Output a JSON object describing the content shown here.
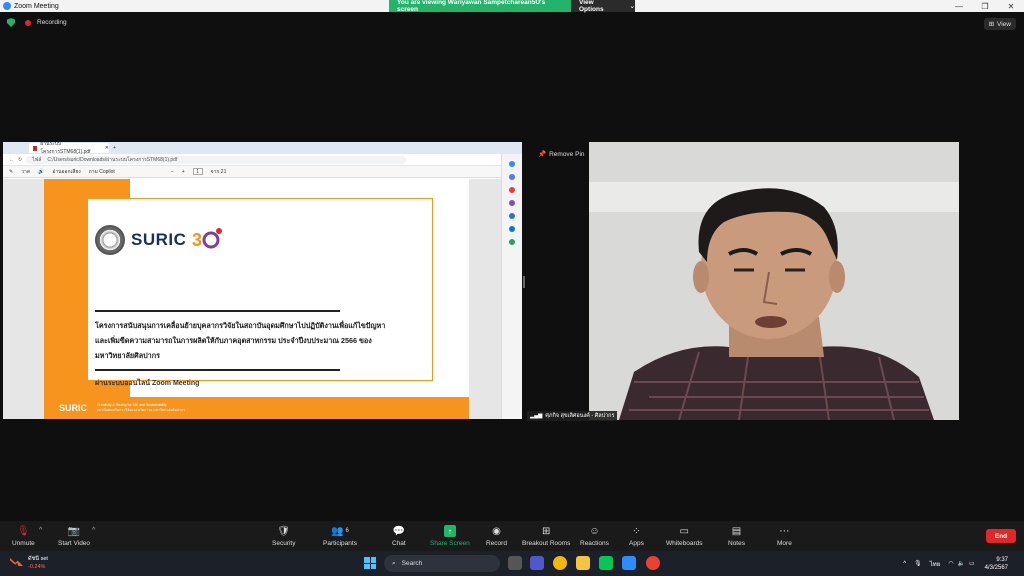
{
  "titlebar": {
    "app_title": "Zoom Meeting",
    "viewing_banner": "You are viewing Wariyawan Sampetcharean5U's screen",
    "view_options": "View Options"
  },
  "recording": {
    "label": "Recording"
  },
  "view_button": "View",
  "browser": {
    "tab_title": "ผ่านระบบโครงการSTM68(1).pdf",
    "url": "C:/Users/suric/Downloads/ผ่านระบบโครงการSTM68(1).pdf",
    "url_prefix": "ไฟล์",
    "pdf_toolbar": {
      "draw": "วาด",
      "read_aloud": "อ่านออกเสียง",
      "ask_copilot": "ถาม Copilot",
      "page_current": "1",
      "page_total": "จาก 21"
    }
  },
  "slide": {
    "suric_logo": "SURIC",
    "title": "โครงการสนับสนุนการเคลื่อนย้ายบุคลากรวิจัยในสถาบันอุดมศึกษาไปปฏิบัติงานเพื่อแก้ไขปัญหาและเพิ่มขีดความสามารถในการผลิตให้กับภาคอุตสาหกรรม ประจำปีงบประมาณ 2566 ของมหาวิทยาลัยศิลปากร",
    "subtitle": "ผ่านระบบออนไลน์ Zoom Meeting",
    "footer_logo": "SURIC",
    "footer_text_1": "Creativity & Reality for Life and Sustainability",
    "footer_text_2": "สถาบันส่งเสริมการวิจัยและนวัตกรรม มหาวิทยาลัยศิลปากร"
  },
  "pin": {
    "label": "Remove Pin"
  },
  "participant": {
    "name": "ศุภกิจ สุขเลิศอนงค์ - ศิลปากร"
  },
  "toolbar": {
    "unmute": "Unmute",
    "start_video": "Start Video",
    "security": "Security",
    "participants": "Participants",
    "participants_count": "6",
    "chat": "Chat",
    "share_screen": "Share Screen",
    "record": "Record",
    "breakout_rooms": "Breakout Rooms",
    "reactions": "Reactions",
    "apps": "Apps",
    "whiteboards": "Whiteboards",
    "notes": "Notes",
    "more": "More",
    "end": "End"
  },
  "taskbar": {
    "stock_name": "ดัชนี set",
    "stock_change": "-0.24%",
    "search": "Search",
    "lang": "ไทย",
    "time": "9:37",
    "date": "4/3/2567"
  },
  "colors": {
    "zoom_green": "#23b36a",
    "end_red": "#e02828",
    "slide_orange": "#f7941d"
  }
}
